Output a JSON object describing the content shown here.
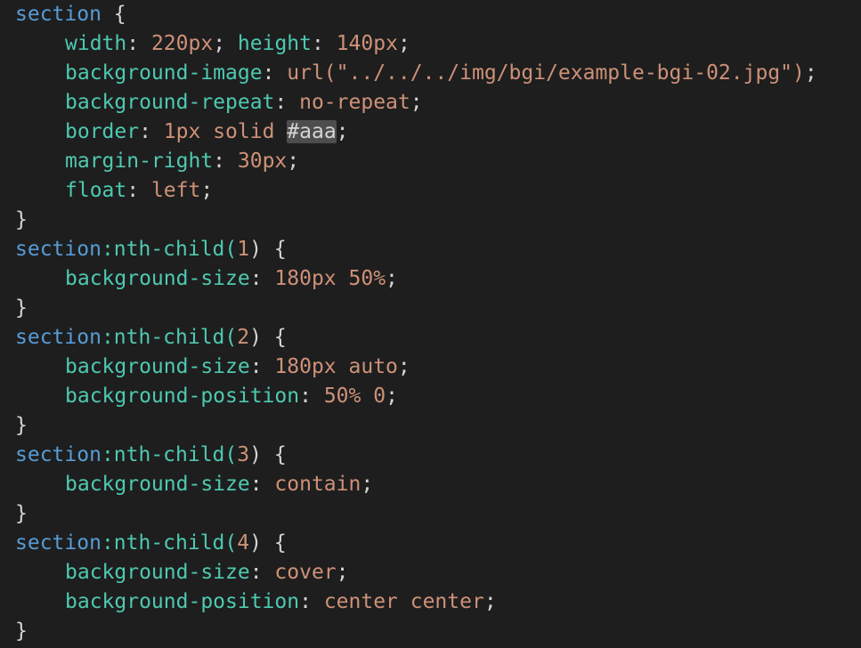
{
  "lines": [
    {
      "t": "sel",
      "selector": "section",
      "rest": " {"
    },
    {
      "t": "decl",
      "prop": "width",
      "val": "220px",
      "sep": "; ",
      "prop2": "height",
      "val2": "140px",
      "end": ";"
    },
    {
      "t": "decl",
      "prop": "background-image",
      "val": "url(\"../../../img/bgi/example-bgi-02.jpg\")",
      "end": ";"
    },
    {
      "t": "decl",
      "prop": "background-repeat",
      "val": "no-repeat",
      "end": ";"
    },
    {
      "t": "decl",
      "prop": "border",
      "val": "1px solid ",
      "hl": "#aaa",
      "end": ";"
    },
    {
      "t": "decl",
      "prop": "margin-right",
      "val": "30px",
      "end": ";"
    },
    {
      "t": "decl",
      "prop": "float",
      "val": "left",
      "end": ";"
    },
    {
      "t": "close",
      "text": "}"
    },
    {
      "t": "sel",
      "selector": "section",
      "pseudo": ":nth-child(",
      "arg": "1",
      "pclose": ")",
      "rest": " {"
    },
    {
      "t": "decl",
      "prop": "background-size",
      "val": "180px 50%",
      "end": ";"
    },
    {
      "t": "close",
      "text": "}"
    },
    {
      "t": "sel",
      "selector": "section",
      "pseudo": ":nth-child(",
      "arg": "2",
      "pclose": ")",
      "rest": " {"
    },
    {
      "t": "decl",
      "prop": "background-size",
      "val": "180px auto",
      "end": ";"
    },
    {
      "t": "decl",
      "prop": "background-position",
      "val": "50% 0",
      "end": ";"
    },
    {
      "t": "close",
      "text": "}"
    },
    {
      "t": "sel",
      "selector": "section",
      "pseudo": ":nth-child(",
      "arg": "3",
      "pclose": ")",
      "rest": " {"
    },
    {
      "t": "decl",
      "prop": "background-size",
      "val": "contain",
      "end": ";"
    },
    {
      "t": "close",
      "text": "}"
    },
    {
      "t": "sel",
      "selector": "section",
      "pseudo": ":nth-child(",
      "arg": "4",
      "pclose": ")",
      "rest": " {"
    },
    {
      "t": "decl",
      "prop": "background-size",
      "val": "cover",
      "end": ";"
    },
    {
      "t": "decl",
      "prop": "background-position",
      "val": "center center",
      "end": ";"
    },
    {
      "t": "close",
      "text": "}"
    }
  ],
  "colors": {
    "background": "#1e1e1e",
    "selector": "#569cd6",
    "property": "#4ec9b0",
    "value": "#ce9178",
    "highlight": "#4d4d4d"
  }
}
